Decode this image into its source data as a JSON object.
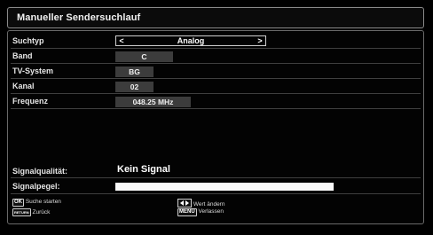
{
  "window": {
    "title": "Manueller Sendersuchlauf"
  },
  "fields": {
    "suchtyp": {
      "label": "Suchtyp",
      "value": "Analog",
      "left_arrow": "<",
      "right_arrow": ">"
    },
    "band": {
      "label": "Band",
      "value": "C"
    },
    "tv_system": {
      "label": "TV-System",
      "value": "BG"
    },
    "kanal": {
      "label": "Kanal",
      "value": "02"
    },
    "frequenz": {
      "label": "Frequenz",
      "value": "048.25 MHz"
    }
  },
  "signal": {
    "quality_label": "Signalqualität:",
    "quality_value": "Kein Signal",
    "level_label": "Signalpegel:",
    "level_percent": 100
  },
  "footer": {
    "ok_key": "OK",
    "ok_text": "Suche starten",
    "return_key": "RETURN",
    "return_text": "Zurück",
    "nav_text": "Wert ändern",
    "menu_key": "MENU",
    "menu_text": "Verlassen"
  },
  "colors": {
    "background": "#000000",
    "value_box": "#3c3c3c",
    "meter": "#fafafa"
  }
}
